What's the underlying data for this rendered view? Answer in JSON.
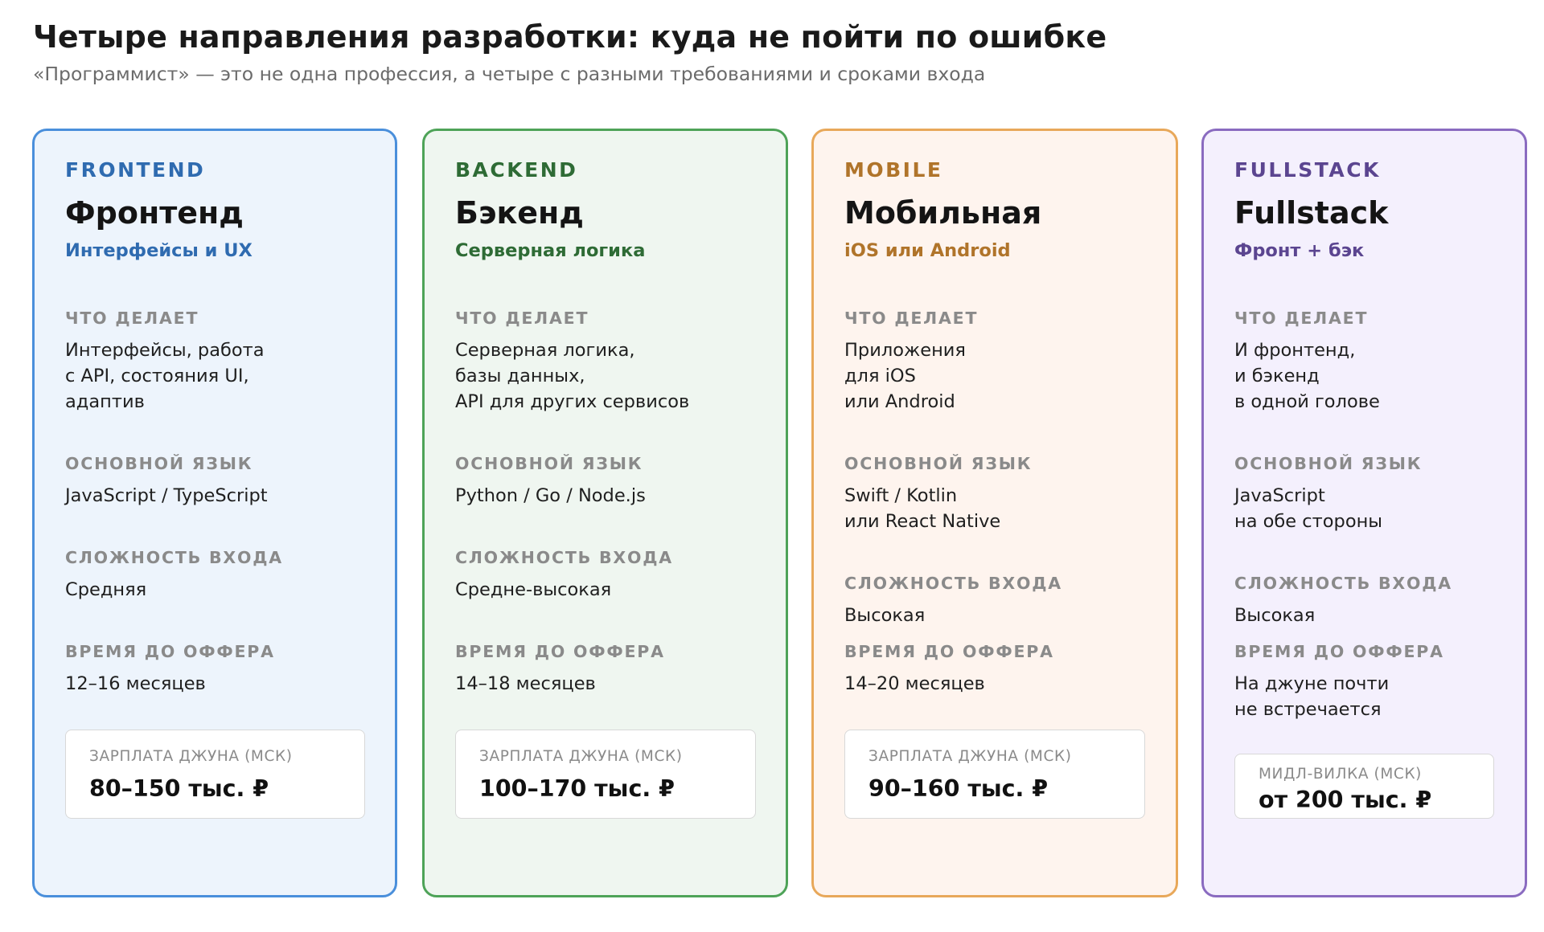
{
  "header": {
    "title": "Четыре направления разработки: куда не пойти по ошибке",
    "subtitle": "«Программист» — это не одна профессия, а четыре с разными требованиями и сроками входа"
  },
  "labels": {
    "does": "ЧТО ДЕЛАЕТ",
    "language": "ОСНОВНОЙ ЯЗЫК",
    "difficulty": "СЛОЖНОСТЬ ВХОДА",
    "time_to_offer": "ВРЕМЯ ДО ОФФЕРА"
  },
  "cards": [
    {
      "tag": "FRONTEND",
      "name": "Фронтенд",
      "tagline": "Интерфейсы и UX",
      "does": [
        "Интерфейсы, работа",
        "с API, состояния UI,",
        "адаптив"
      ],
      "language": [
        "JavaScript / TypeScript"
      ],
      "difficulty": "Средняя",
      "time_to_offer": [
        "12–16 месяцев"
      ],
      "salary_label": "ЗАРПЛАТА ДЖУНА (МСК)",
      "salary_value": "80–150 тыс. ₽",
      "accent": "#2f6bb0",
      "border": "#4a8fdb",
      "bg": "#edf4fc"
    },
    {
      "tag": "BACKEND",
      "name": "Бэкенд",
      "tagline": "Серверная логика",
      "does": [
        "Серверная логика,",
        "базы данных,",
        "API для других сервисов"
      ],
      "language": [
        "Python / Go / Node.js"
      ],
      "difficulty": "Средне-высокая",
      "time_to_offer": [
        "14–18 месяцев"
      ],
      "salary_label": "ЗАРПЛАТА ДЖУНА (МСК)",
      "salary_value": "100–170 тыс. ₽",
      "accent": "#2e6b35",
      "border": "#4ea358",
      "bg": "#eff6f0"
    },
    {
      "tag": "MOBILE",
      "name": "Мобильная",
      "tagline": "iOS или Android",
      "does": [
        "Приложения",
        "для iOS",
        "или Android"
      ],
      "language": [
        "Swift / Kotlin",
        "или React Native"
      ],
      "difficulty": "Высокая",
      "time_to_offer": [
        "14–20 месяцев"
      ],
      "salary_label": "ЗАРПЛАТА ДЖУНА (МСК)",
      "salary_value": "90–160 тыс. ₽",
      "accent": "#b0742a",
      "border": "#e8a85a",
      "bg": "#fef4ee"
    },
    {
      "tag": "FULLSTACK",
      "name": "Fullstack",
      "tagline": "Фронт + бэк",
      "does": [
        "И фронтенд,",
        "и бэкенд",
        "в одной голове"
      ],
      "language": [
        "JavaScript",
        "на обе стороны"
      ],
      "difficulty": "Высокая",
      "time_to_offer": [
        "На джуне почти",
        "не встречается"
      ],
      "salary_label": "МИДЛ-ВИЛКА (МСК)",
      "salary_value": "от 200 тыс. ₽",
      "accent": "#5b4590",
      "border": "#8a6bc0",
      "bg": "#f4f0fd"
    }
  ]
}
